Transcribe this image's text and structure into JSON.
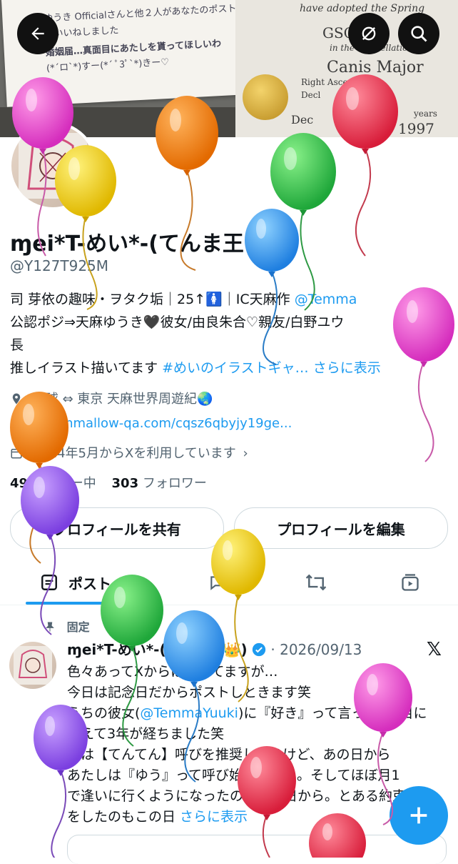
{
  "banner": {
    "card_lines": [
      "ゆうき Officialさんと他２人があなたのポスト",
      "をいいねしました",
      "婚姻届…真面目にあたしを貰ってほしいわ",
      "(*´ロ`*)すー(*´ ﾟ3ﾟ`*)きー♡"
    ],
    "cert_lines": [
      "have adopted the Spring",
      "GSC",
      "in the constellation",
      "Canis Major",
      "Right Ascension",
      "Decl",
      "Dec",
      "1997",
      "years"
    ]
  },
  "header": {
    "back_icon": "arrow-left-icon",
    "mute_icon": "eye-slash-icon",
    "search_icon": "search-icon"
  },
  "profile": {
    "name": "ɱei*T-めい*-(てんま王",
    "handle": "@Y127T925M",
    "bio_lines": [
      {
        "text": "司 芽依の趣味・ヲタク垢｜25↑🚺｜IC天麻作 ",
        "link": "@Temma"
      },
      {
        "text": "公認ポジ⇒天麻ゆうき🖤彼女/由良朱合♡親友/白野ユウ",
        "link": ""
      },
      {
        "text": "長",
        "link": ""
      },
      {
        "text": "推しイラスト描いてます ",
        "link": "#めいのイラストギャ… さらに表示"
      }
    ],
    "location": "琉球 ⇔ 東京 天麻世界周遊紀🌏",
    "website": "marshmallow-qa.com/cqsz6qbyjy19ge...",
    "joined": "2014年5月からXを利用しています",
    "following_count": "49",
    "following_label": "フォロー中",
    "followers_count": "303",
    "followers_label": "フォロワー",
    "share_button": "プロフィールを共有",
    "edit_button": "プロフィールを編集"
  },
  "tabs": [
    {
      "label": "ポスト",
      "icon": "post-icon"
    },
    {
      "label": "",
      "icon": "chat-icon"
    },
    {
      "label": "",
      "icon": "repost-icon"
    },
    {
      "label": "",
      "icon": "video-icon"
    }
  ],
  "post": {
    "pinned_label": "固定",
    "author": "ɱei*T-めい*-(てんま王👑)",
    "date": "· 2026/09/13",
    "lines": [
      {
        "text": "色々あってXからは離れてますが…",
        "link": ""
      },
      {
        "text": "今日は記念日だからポストしときます笑",
        "link": ""
      },
      {
        "text": "うちの彼女(",
        "link": "@TemmaYuuki",
        "after": ")に『好き』って言って2回目に"
      },
      {
        "text": "答えて3年が経ちました笑",
        "link": ""
      },
      {
        "text": "今は【てんてん】呼びを推奨してるけど、あの日から",
        "link": ""
      },
      {
        "text": "あたしは『ゆう』って呼び始めました。そしてほぼ月1",
        "link": ""
      },
      {
        "text": "で逢いに行くようになったのもあの日から。とある約束",
        "link": ""
      },
      {
        "text": "をしたのもこの日 ",
        "link": "さらに表示"
      }
    ]
  },
  "fab_icon": "plus-icon",
  "colors": {
    "accent": "#1d9bf0",
    "text": "#0f1419",
    "muted": "#536471"
  },
  "balloon_colors": [
    "pink",
    "yellow",
    "orange",
    "green",
    "red",
    "blue",
    "purple"
  ]
}
